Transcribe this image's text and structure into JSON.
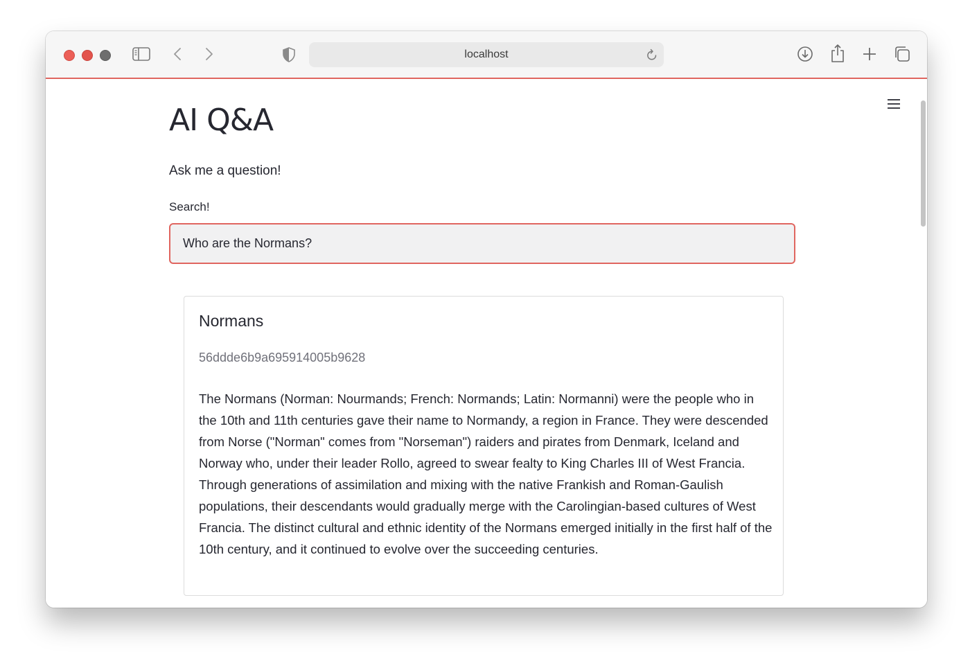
{
  "browser": {
    "url": "localhost",
    "icons": [
      "sidebar-icon",
      "back-icon",
      "forward-icon",
      "shield-icon",
      "reload-icon",
      "download-icon",
      "share-icon",
      "new-tab-icon",
      "tab-overview-icon"
    ]
  },
  "app": {
    "title": "AI Q&A",
    "subtitle": "Ask me a question!",
    "search_label": "Search!",
    "search_value": "Who are the Normans?",
    "menu_icon": "hamburger-menu-icon",
    "accent_color": "#e0655f"
  },
  "result": {
    "title": "Normans",
    "id": "56ddde6b9a695914005b9628",
    "text": "The Normans (Norman: Nourmands; French: Normands; Latin: Normanni) were the people who in the 10th and 11th centuries gave their name to Normandy, a region in France. They were descended from Norse (\"Norman\" comes from \"Norseman\") raiders and pirates from Denmark, Iceland and Norway who, under their leader Rollo, agreed to swear fealty to King Charles III of West Francia. Through generations of assimilation and mixing with the native Frankish and Roman-Gaulish populations, their descendants would gradually merge with the Carolingian-based cultures of West Francia. The distinct cultural and ethnic identity of the Normans emerged initially in the first half of the 10th century, and it continued to evolve over the succeeding centuries."
  }
}
